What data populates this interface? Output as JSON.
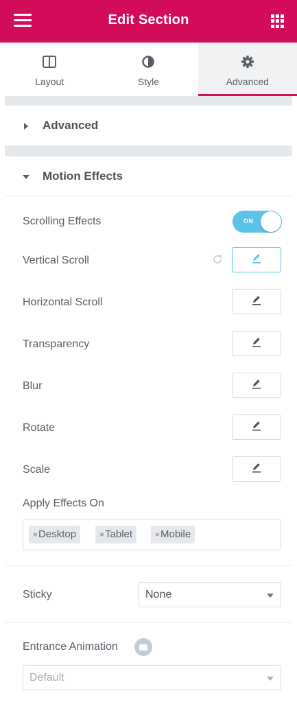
{
  "header": {
    "title": "Edit Section",
    "menu_icon": "hamburger-menu-icon",
    "apps_icon": "grid-apps-icon",
    "background": "#d30c5c"
  },
  "tabs": [
    {
      "label": "Layout",
      "icon": "columns-layout-icon",
      "active": false
    },
    {
      "label": "Style",
      "icon": "half-circle-contrast-icon",
      "active": false
    },
    {
      "label": "Advanced",
      "icon": "gear-icon",
      "active": true
    }
  ],
  "sections": {
    "advanced": {
      "label": "Advanced",
      "expanded": false
    },
    "motion_effects": {
      "label": "Motion Effects",
      "expanded": true
    }
  },
  "motion": {
    "scrolling_effects": {
      "label": "Scrolling Effects",
      "toggle_text": "ON",
      "enabled": true
    },
    "effects": [
      {
        "label": "Vertical Scroll",
        "active": true,
        "has_reset": true
      },
      {
        "label": "Horizontal Scroll",
        "active": false
      },
      {
        "label": "Transparency",
        "active": false
      },
      {
        "label": "Blur",
        "active": false
      },
      {
        "label": "Rotate",
        "active": false
      },
      {
        "label": "Scale",
        "active": false
      }
    ],
    "apply_effects_on": {
      "label": "Apply Effects On",
      "chips": [
        "Desktop",
        "Tablet",
        "Mobile"
      ],
      "remove_glyph": "×"
    }
  },
  "sticky": {
    "label": "Sticky",
    "value": "None"
  },
  "entrance_animation": {
    "label": "Entrance Animation",
    "value": "Default",
    "info_icon": "info-comment-icon"
  },
  "colors": {
    "accent": "#d30c5c",
    "toggle_on": "#5bc3e8",
    "panel_gap": "#e6e9ec"
  }
}
